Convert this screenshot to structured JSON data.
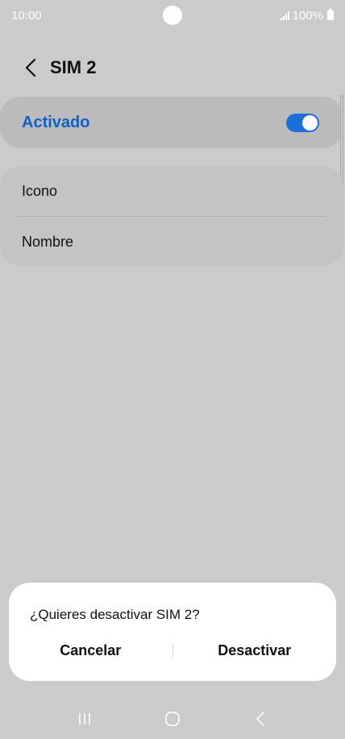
{
  "status_bar": {
    "time": "10:00",
    "battery": "100%"
  },
  "header": {
    "title": "SIM 2",
    "back_icon": "chevron-left-icon"
  },
  "activated": {
    "label": "Activado",
    "enabled": true,
    "accent_color": "#0e5fc7"
  },
  "list": {
    "items": [
      {
        "label": "Icono"
      },
      {
        "label": "Nombre"
      }
    ]
  },
  "dialog": {
    "question": "¿Quieres desactivar SIM 2?",
    "cancel_label": "Cancelar",
    "confirm_label": "Desactivar"
  },
  "nav_bar": {
    "icons": [
      "recent-apps-icon",
      "home-icon",
      "back-icon"
    ]
  }
}
